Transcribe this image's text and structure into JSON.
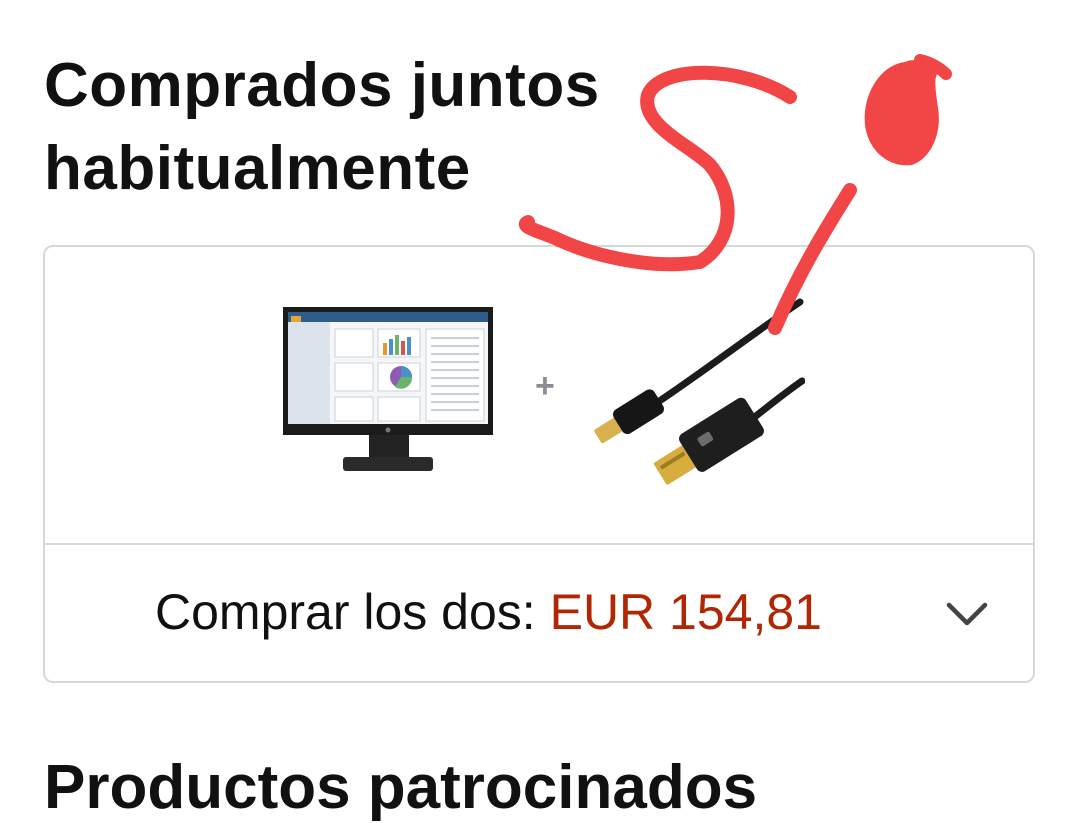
{
  "section": {
    "title": "Comprados juntos habitualmente"
  },
  "bundle": {
    "products": [
      {
        "name": "monitor",
        "image_icon": "monitor-image"
      },
      {
        "name": "cable",
        "image_icon": "mini-displayport-to-hdmi-cable-image"
      }
    ],
    "plus": "+",
    "buy_label": "Comprar los dos: ",
    "price": "EUR 154,81",
    "expand_icon": "chevron-down-icon"
  },
  "next_section": {
    "title": "Productos patrocinados"
  },
  "colors": {
    "price": "#b12704",
    "border": "#d5d9d9",
    "annotation": "#f24646"
  }
}
